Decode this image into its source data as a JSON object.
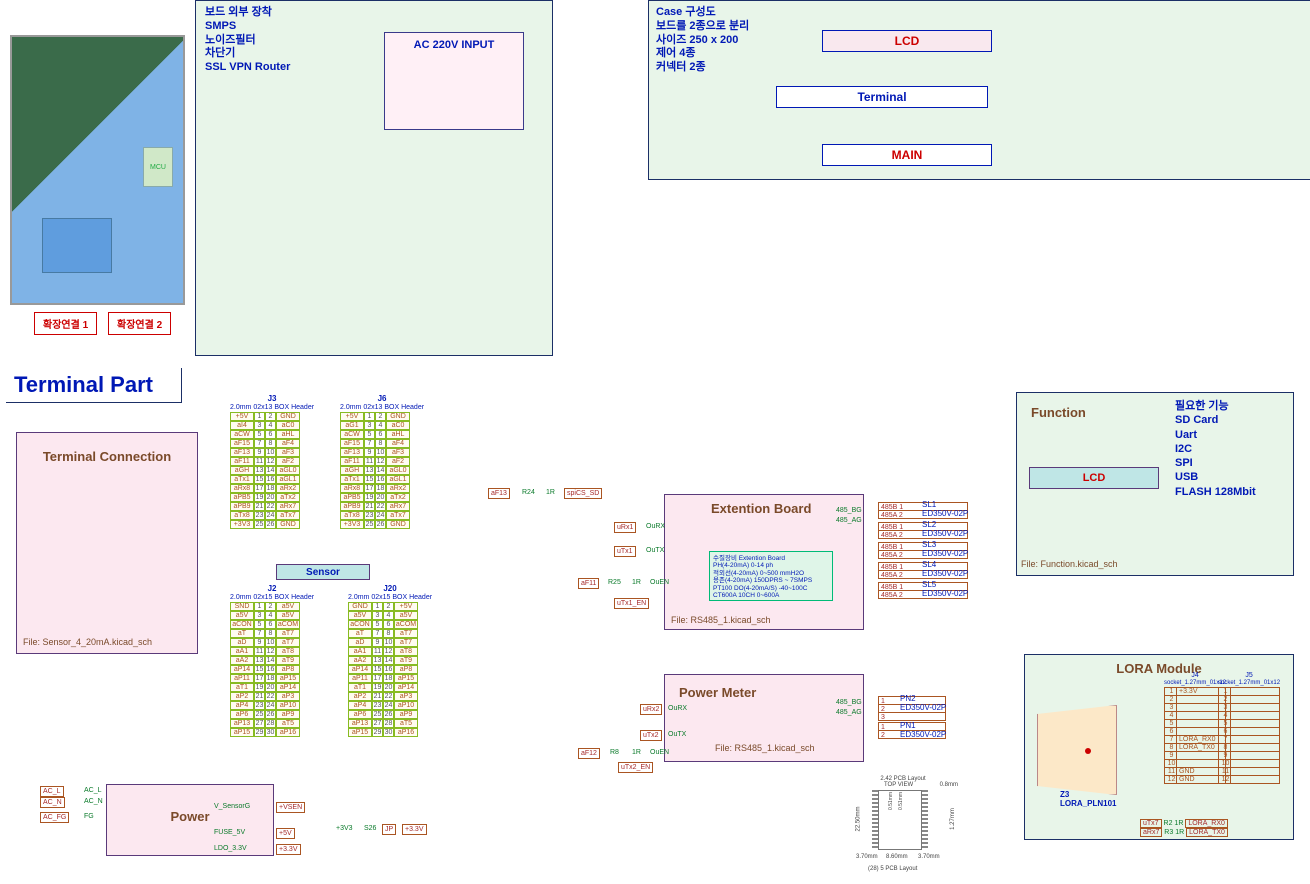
{
  "panel_left": {
    "notes": "보드 외부 장착\nSMPS\n노이즈필터\n차단기\nSSL VPN Router",
    "ac_box": "AC 220V INPUT",
    "ext_btn1": "확장연결 1",
    "ext_btn2": "확장연결 2",
    "mcu_label": "MCU"
  },
  "panel_right": {
    "notes": "Case 구성도\n보드를 2종으로 분리\n사이즈 250 x 200\n제어   4종\n커넥터 2종",
    "lcd": "LCD",
    "terminal": "Terminal",
    "main": "MAIN"
  },
  "terminal_title": "Terminal Part",
  "term_conn": {
    "title": "Terminal Connection",
    "file": "File: Sensor_4_20mA.kicad_sch"
  },
  "power": {
    "title": "Power",
    "in": [
      "AC_L",
      "AC_N",
      "AC_FG"
    ],
    "sig": [
      "AC_L",
      "AC_N",
      "FG"
    ],
    "out": [
      "V_SensorG",
      "FUSE_5V",
      "LDO_3.3V"
    ],
    "out_t": [
      "+VSEN",
      "+5V",
      "+3.3V"
    ],
    "free": [
      "+3V3",
      "S26",
      "JP",
      "+3.3V"
    ]
  },
  "sensor_label": "Sensor",
  "headers": {
    "j3": {
      "name": "J3",
      "desc": "2.0mm 02x13 BOX Header",
      "left": [
        "+5V",
        "aI4",
        "aCW",
        "aF15",
        "aF13",
        "aF11",
        "aGH",
        "aTx1",
        "aRx8",
        "aPB5",
        "aPB9",
        "aTx8",
        "+3V3"
      ],
      "right": [
        "GND",
        "aC0",
        "aHL",
        "aF4",
        "aF3",
        "aF2",
        "aGL0",
        "aGL1",
        "aRx2",
        "aTx2",
        "aRx7",
        "aTx7",
        "GND"
      ]
    },
    "j6": {
      "name": "J6",
      "desc": "2.0mm 02x13 BOX Header",
      "left": [
        "+5V",
        "aG1",
        "aCW",
        "aF15",
        "aF13",
        "aF11",
        "aGH",
        "aTx1",
        "aRx8",
        "aPB5",
        "aPB9",
        "aTx8",
        "+3V3"
      ],
      "right": [
        "GND",
        "aC0",
        "aHL",
        "aF4",
        "aF3",
        "aF2",
        "aGL0",
        "aGL1",
        "aRx2",
        "aTx2",
        "aRx7",
        "aTx7",
        "GND"
      ]
    },
    "j2": {
      "name": "J2",
      "desc": "2.0mm 02x15 BOX Header",
      "left": [
        "SND",
        "a5V",
        "aCON",
        "aT",
        "aD",
        "aA1",
        "aA2",
        "aP14",
        "aP11",
        "aT1",
        "aP2",
        "aP4",
        "aP6",
        "aP13",
        "aP15"
      ],
      "right": [
        "a5V",
        "a5V",
        "aCOM",
        "aT7",
        "aT7",
        "aT8",
        "aT9",
        "aP8",
        "aP15",
        "aP14",
        "aP3",
        "aP10",
        "aP9",
        "aT5",
        "aP16"
      ]
    },
    "j20": {
      "name": "J20",
      "desc": "2.0mm 02x15 BOX Header",
      "left": [
        "GND",
        "a5V",
        "aCON",
        "aT",
        "aD",
        "aA1",
        "aA2",
        "aP14",
        "aP11",
        "aT1",
        "aP2",
        "aP4",
        "aP6",
        "aP13",
        "aP15"
      ],
      "right": [
        "+5V",
        "a5V",
        "aCOM",
        "aT7",
        "aT7",
        "aT8",
        "aT9",
        "aP8",
        "aP15",
        "aP14",
        "aP3",
        "aP10",
        "aP9",
        "aT5",
        "aP16"
      ]
    }
  },
  "ext_board": {
    "title": "Extention Board",
    "desc": "수질장비 Extention Board\nPH(4-20mA) 0-14 ph\n적외선(4-20mA) 0~500 mmH2O\n용존(4-20mA) 150DPRS ~ 7SMPS\nPT100 DO(4-20mA/S) -40~100C\nCT600A 10CH 0~600A",
    "file": "File: RS485_1.kicad_sch",
    "left_sig": [
      "aF13",
      "uRx1",
      "uTx1",
      "aF11",
      "uTx1_EN"
    ],
    "left_res": [
      "R24",
      "R25",
      "R8"
    ],
    "left_imp": [
      "1R",
      "1R",
      "1R"
    ],
    "left_f": [
      "spiCS_SD",
      "OuRX",
      "OuTX",
      "OuEN"
    ],
    "bus": [
      "485_BG",
      "485_AG"
    ],
    "slots": [
      {
        "name": "SL1",
        "part": "ED350V-02P",
        "pins": [
          "485B  1",
          "485A  2"
        ]
      },
      {
        "name": "SL2",
        "part": "ED350V-02P",
        "pins": [
          "485B  1",
          "485A  2"
        ]
      },
      {
        "name": "SL3",
        "part": "ED350V-02P",
        "pins": [
          "485B  1",
          "485A  2"
        ]
      },
      {
        "name": "SL4",
        "part": "ED350V-02P",
        "pins": [
          "485B  1",
          "485A  2"
        ]
      },
      {
        "name": "SL5",
        "part": "ED350V-02P",
        "pins": [
          "485B  1",
          "485A  2"
        ]
      }
    ]
  },
  "power_meter": {
    "title": "Power Meter",
    "file": "File: RS485_1.kicad_sch",
    "left_sig": [
      "uRx2",
      "uTx2",
      "aF12",
      "uTx2_EN"
    ],
    "left_res": "R8",
    "left_imp": "1R",
    "left_f": [
      "OuRX",
      "OuTX",
      "OuEN"
    ],
    "bus": [
      "485_BG",
      "485_AG"
    ],
    "pn": [
      {
        "name": "PN2",
        "part": "ED350V-02P",
        "pins": [
          "1",
          "2",
          "3"
        ]
      },
      {
        "name": "PN1",
        "part": "ED350V-02P",
        "pins": [
          "1",
          "2"
        ]
      }
    ]
  },
  "function": {
    "title": "Function",
    "lcd": "LCD",
    "file": "File: Function.kicad_sch",
    "notes": "필요한 기능\nSD Card\nUart\nI2C\nSPI\nUSB\nFLASH 128Mbit"
  },
  "lora": {
    "title": "LORA Module",
    "ref": "Z3",
    "part": "LORA_PLN101",
    "j4": {
      "name": "J4",
      "desc": "socket_1.27mm_01x12",
      "pins": [
        [
          "1",
          "+3.3V"
        ],
        [
          "2",
          ""
        ],
        [
          "3",
          ""
        ],
        [
          "4",
          ""
        ],
        [
          "5",
          ""
        ],
        [
          "6",
          ""
        ],
        [
          "7",
          "LORA_RX0"
        ],
        [
          "8",
          "LORA_TX0"
        ],
        [
          "9",
          ""
        ],
        [
          "10",
          ""
        ],
        [
          "11",
          "GND"
        ],
        [
          "12",
          "GND"
        ]
      ]
    },
    "j5": {
      "name": "J5",
      "desc": "socket_1.27mm_01x12",
      "pins": [
        [
          "1",
          ""
        ],
        [
          "2",
          ""
        ],
        [
          "3",
          ""
        ],
        [
          "4",
          ""
        ],
        [
          "5",
          ""
        ],
        [
          "6",
          ""
        ],
        [
          "7",
          ""
        ],
        [
          "8",
          ""
        ],
        [
          "9",
          ""
        ],
        [
          "10",
          ""
        ],
        [
          "11",
          ""
        ],
        [
          "12",
          ""
        ]
      ]
    },
    "bottom": [
      {
        "sig": "uTx7",
        "r": "R2",
        "imp": "1R",
        "net": "LORA_RX0"
      },
      {
        "sig": "aRx7",
        "r": "R3",
        "imp": "1R",
        "net": "LORA_TX0"
      }
    ]
  },
  "topview": {
    "title": "2.42 PCB Layout",
    "label": "TOP VIEW",
    "dims": [
      "0.8mm",
      "22.50mm",
      "0.51mm",
      "0.51mm",
      "1.27mm",
      "3.70mm",
      "8.60mm",
      "3.70mm",
      "(28) 5 PCB Layout"
    ]
  }
}
